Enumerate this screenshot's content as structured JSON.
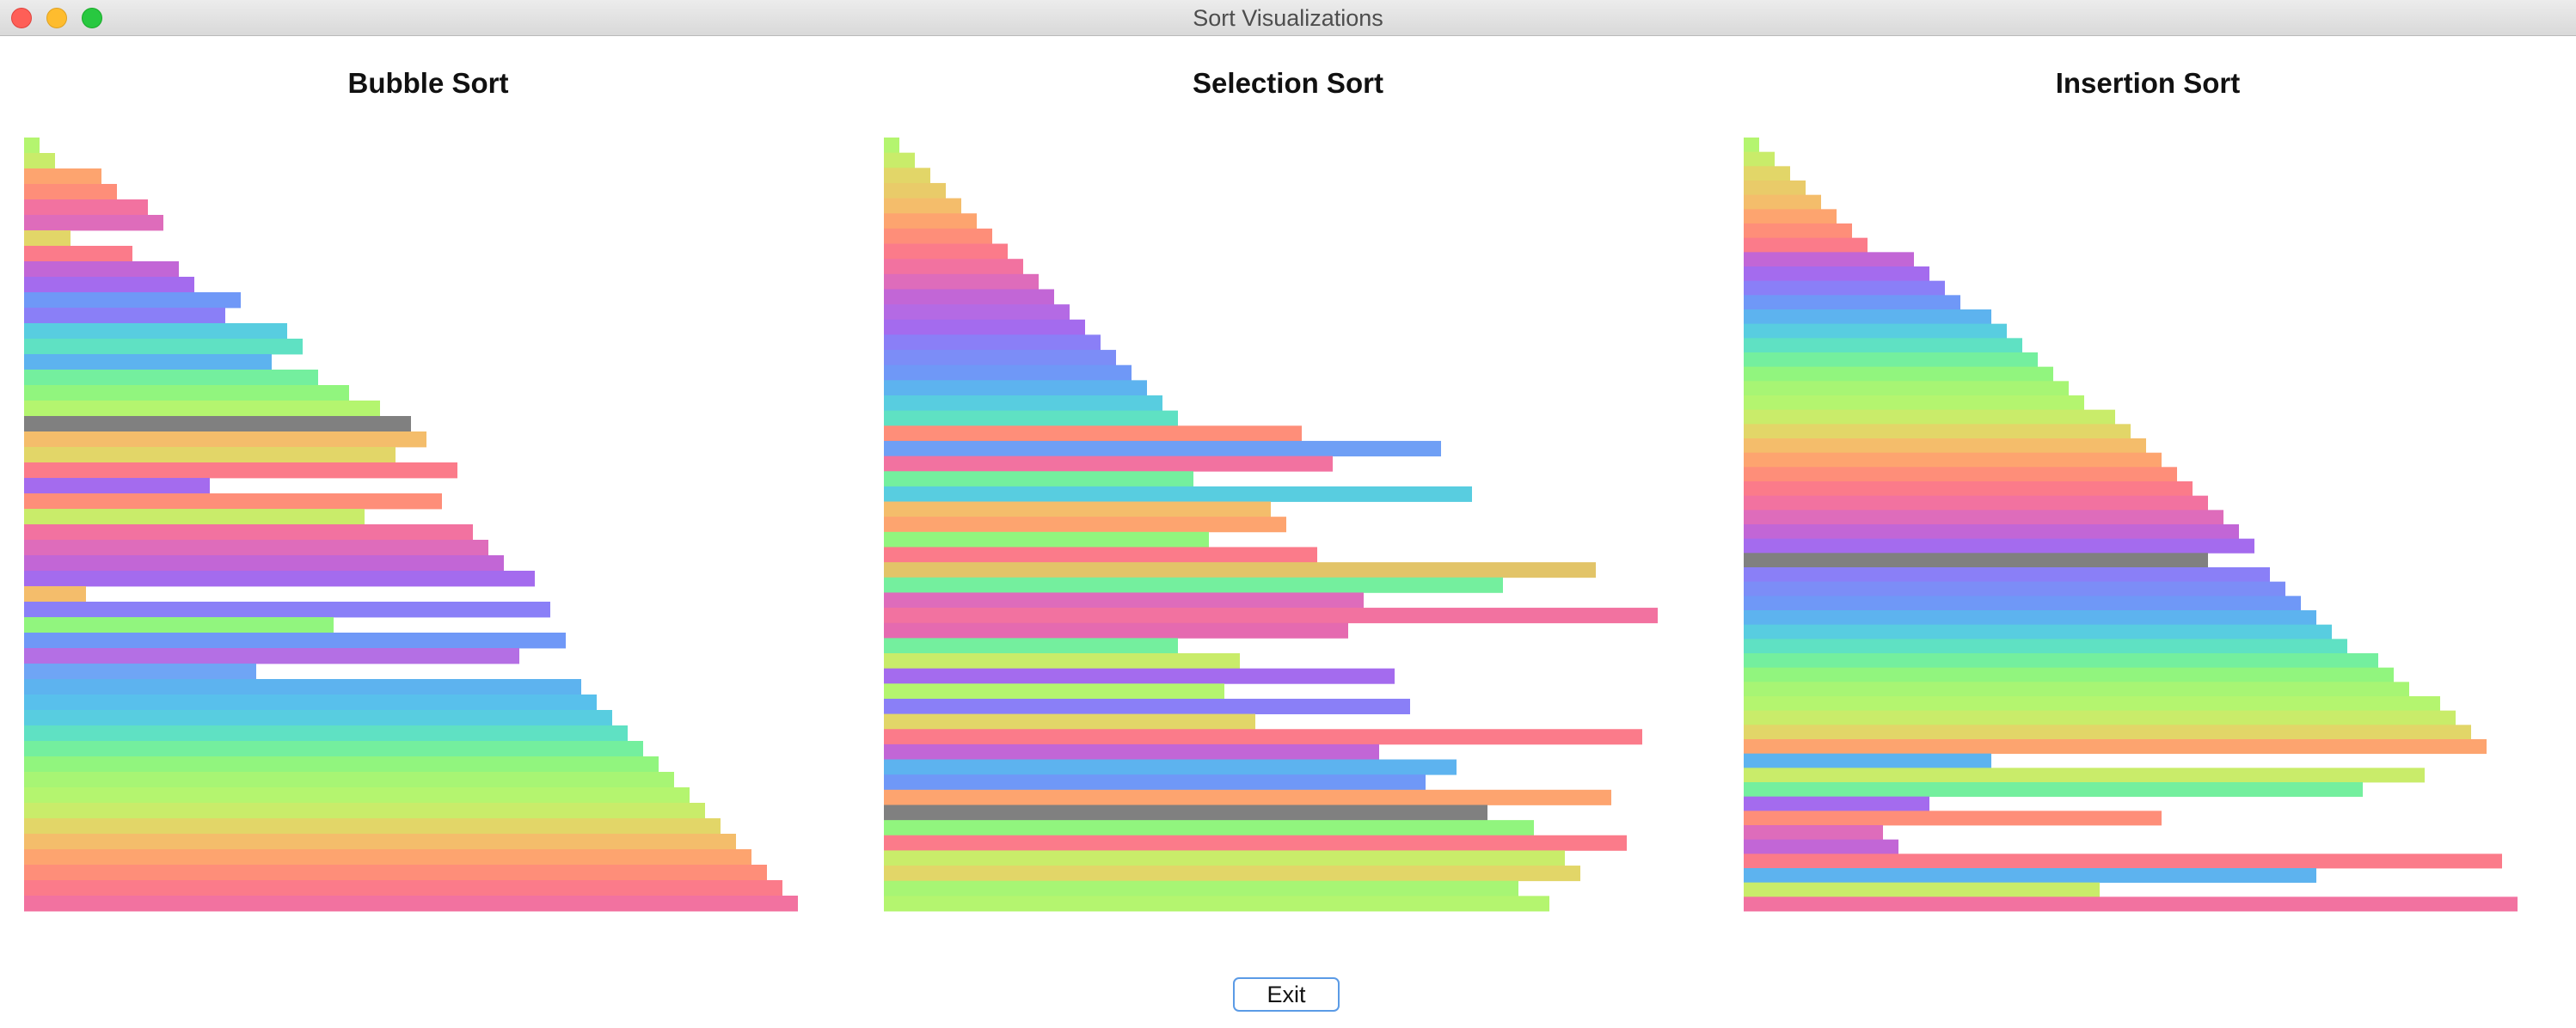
{
  "window": {
    "title": "Sort Visualizations"
  },
  "colors": {
    "highlight": "#808080",
    "palette": [
      "#b4f56f",
      "#c9ec6a",
      "#e2d668",
      "#f4bd6b",
      "#fda46f",
      "#fe8e79",
      "#fb7b8a",
      "#f272a0",
      "#de6cbb",
      "#c266d6",
      "#a46bee",
      "#8a7ff7",
      "#6f98f7",
      "#5db3ef",
      "#58cde0",
      "#5fe1c3",
      "#74ef9e",
      "#91f57e"
    ]
  },
  "panels": [
    {
      "title": "Bubble Sort",
      "bars": [
        {
          "value": 1,
          "color": "#b4f56f"
        },
        {
          "value": 2,
          "color": "#c9ec6a"
        },
        {
          "value": 5,
          "color": "#fda46f"
        },
        {
          "value": 6,
          "color": "#fe8e79"
        },
        {
          "value": 8,
          "color": "#f272a0"
        },
        {
          "value": 9,
          "color": "#de6cbb"
        },
        {
          "value": 3,
          "color": "#e2d668"
        },
        {
          "value": 7,
          "color": "#fb7b8a"
        },
        {
          "value": 10,
          "color": "#c266d6"
        },
        {
          "value": 11,
          "color": "#a46bee"
        },
        {
          "value": 14,
          "color": "#6f98f7"
        },
        {
          "value": 13,
          "color": "#8a7ff7"
        },
        {
          "value": 17,
          "color": "#58cde0"
        },
        {
          "value": 18,
          "color": "#5fe1c3"
        },
        {
          "value": 16,
          "color": "#5db3ef"
        },
        {
          "value": 19,
          "color": "#74ef9e"
        },
        {
          "value": 21,
          "color": "#91f57e"
        },
        {
          "value": 23,
          "color": "#b4f56f"
        },
        {
          "value": 25,
          "color": "#808080"
        },
        {
          "value": 26,
          "color": "#f4bd6b"
        },
        {
          "value": 24,
          "color": "#e2d668"
        },
        {
          "value": 28,
          "color": "#fb7b8a"
        },
        {
          "value": 12,
          "color": "#a46bee"
        },
        {
          "value": 27,
          "color": "#fe8e79"
        },
        {
          "value": 22,
          "color": "#c9ec6a"
        },
        {
          "value": 29,
          "color": "#f272a0"
        },
        {
          "value": 30,
          "color": "#de6cbb"
        },
        {
          "value": 31,
          "color": "#c266d6"
        },
        {
          "value": 33,
          "color": "#a46bee"
        },
        {
          "value": 4,
          "color": "#f4bd6b"
        },
        {
          "value": 34,
          "color": "#8a7ff7"
        },
        {
          "value": 20,
          "color": "#91f57e"
        },
        {
          "value": 35,
          "color": "#6f98f7"
        },
        {
          "value": 32,
          "color": "#b46fe4"
        },
        {
          "value": 15,
          "color": "#6fa5f5"
        },
        {
          "value": 36,
          "color": "#5db3ef"
        },
        {
          "value": 37,
          "color": "#58c0ec"
        },
        {
          "value": 38,
          "color": "#58cde0"
        },
        {
          "value": 39,
          "color": "#5fe1c3"
        },
        {
          "value": 40,
          "color": "#74ef9e"
        },
        {
          "value": 41,
          "color": "#91f57e"
        },
        {
          "value": 42,
          "color": "#a7f574"
        },
        {
          "value": 43,
          "color": "#b4f56f"
        },
        {
          "value": 44,
          "color": "#c9ec6a"
        },
        {
          "value": 45,
          "color": "#e2d668"
        },
        {
          "value": 46,
          "color": "#f4bd6b"
        },
        {
          "value": 47,
          "color": "#fda46f"
        },
        {
          "value": 48,
          "color": "#fe8e79"
        },
        {
          "value": 49,
          "color": "#fb7b8a"
        },
        {
          "value": 50,
          "color": "#f272a0"
        }
      ]
    },
    {
      "title": "Selection Sort",
      "bars": [
        {
          "value": 1,
          "color": "#b4f56f"
        },
        {
          "value": 2,
          "color": "#c9ec6a"
        },
        {
          "value": 3,
          "color": "#e2d668"
        },
        {
          "value": 4,
          "color": "#e9cb69"
        },
        {
          "value": 5,
          "color": "#f4bd6b"
        },
        {
          "value": 6,
          "color": "#fda46f"
        },
        {
          "value": 7,
          "color": "#fe8e79"
        },
        {
          "value": 8,
          "color": "#fb7b8a"
        },
        {
          "value": 9,
          "color": "#f272a0"
        },
        {
          "value": 10,
          "color": "#de6cbb"
        },
        {
          "value": 11,
          "color": "#c266d6"
        },
        {
          "value": 12,
          "color": "#b46ae4"
        },
        {
          "value": 13,
          "color": "#a46bee"
        },
        {
          "value": 14,
          "color": "#8a7ff7"
        },
        {
          "value": 15,
          "color": "#7c8df7"
        },
        {
          "value": 16,
          "color": "#6f98f7"
        },
        {
          "value": 17,
          "color": "#5db3ef"
        },
        {
          "value": 18,
          "color": "#58cde0"
        },
        {
          "value": 19,
          "color": "#5fe1c3"
        },
        {
          "value": 27,
          "color": "#fe8e79"
        },
        {
          "value": 36,
          "color": "#6f9ff5"
        },
        {
          "value": 29,
          "color": "#f272a0"
        },
        {
          "value": 20,
          "color": "#74ef9e"
        },
        {
          "value": 38,
          "color": "#58cde0"
        },
        {
          "value": 25,
          "color": "#f4bd6b"
        },
        {
          "value": 26,
          "color": "#fda46f"
        },
        {
          "value": 21,
          "color": "#91f57e"
        },
        {
          "value": 28,
          "color": "#fb7b8a"
        },
        {
          "value": 46,
          "color": "#e2c468"
        },
        {
          "value": 40,
          "color": "#74ef9e"
        },
        {
          "value": 31,
          "color": "#de6cbb"
        },
        {
          "value": 50,
          "color": "#f272a0"
        },
        {
          "value": 30,
          "color": "#e56ab0"
        },
        {
          "value": 19,
          "color": "#74ef9e"
        },
        {
          "value": 23,
          "color": "#c9ec6a"
        },
        {
          "value": 33,
          "color": "#a46bee"
        },
        {
          "value": 22,
          "color": "#b4f56f"
        },
        {
          "value": 34,
          "color": "#8a7ff7"
        },
        {
          "value": 24,
          "color": "#e2d668"
        },
        {
          "value": 49,
          "color": "#fb7b8a"
        },
        {
          "value": 32,
          "color": "#c266d6"
        },
        {
          "value": 37,
          "color": "#5db3ef"
        },
        {
          "value": 35,
          "color": "#6f98f7"
        },
        {
          "value": 47,
          "color": "#fda46f"
        },
        {
          "value": 39,
          "color": "#808080"
        },
        {
          "value": 42,
          "color": "#91f57e"
        },
        {
          "value": 48,
          "color": "#fb7b8a"
        },
        {
          "value": 44,
          "color": "#c9ec6a"
        },
        {
          "value": 45,
          "color": "#e2d668"
        },
        {
          "value": 41,
          "color": "#a7f574"
        },
        {
          "value": 43,
          "color": "#b4f56f"
        }
      ]
    },
    {
      "title": "Insertion Sort",
      "bars": [
        {
          "value": 1,
          "color": "#b4f56f"
        },
        {
          "value": 2,
          "color": "#c9ec6a"
        },
        {
          "value": 3,
          "color": "#e2d668"
        },
        {
          "value": 4,
          "color": "#e9cb69"
        },
        {
          "value": 5,
          "color": "#f4bd6b"
        },
        {
          "value": 6,
          "color": "#fda46f"
        },
        {
          "value": 7,
          "color": "#fe8e79"
        },
        {
          "value": 8,
          "color": "#fb7b8a"
        },
        {
          "value": 11,
          "color": "#c266d6"
        },
        {
          "value": 12,
          "color": "#a46bee"
        },
        {
          "value": 13,
          "color": "#8a7ff7"
        },
        {
          "value": 14,
          "color": "#6f98f7"
        },
        {
          "value": 16,
          "color": "#5db3ef"
        },
        {
          "value": 17,
          "color": "#58cde0"
        },
        {
          "value": 18,
          "color": "#5fe1c3"
        },
        {
          "value": 19,
          "color": "#74ef9e"
        },
        {
          "value": 20,
          "color": "#91f57e"
        },
        {
          "value": 21,
          "color": "#a7f574"
        },
        {
          "value": 22,
          "color": "#b4f56f"
        },
        {
          "value": 24,
          "color": "#c9ec6a"
        },
        {
          "value": 25,
          "color": "#e2d668"
        },
        {
          "value": 26,
          "color": "#f4bd6b"
        },
        {
          "value": 27,
          "color": "#fda46f"
        },
        {
          "value": 28,
          "color": "#fe8e79"
        },
        {
          "value": 29,
          "color": "#fb7b8a"
        },
        {
          "value": 30,
          "color": "#f272a0"
        },
        {
          "value": 31,
          "color": "#de6cbb"
        },
        {
          "value": 32,
          "color": "#c266d6"
        },
        {
          "value": 33,
          "color": "#a46bee"
        },
        {
          "value": 30,
          "color": "#808080"
        },
        {
          "value": 34,
          "color": "#8a7ff7"
        },
        {
          "value": 35,
          "color": "#7c8df7"
        },
        {
          "value": 36,
          "color": "#6f98f7"
        },
        {
          "value": 37,
          "color": "#5db3ef"
        },
        {
          "value": 38,
          "color": "#58cde0"
        },
        {
          "value": 39,
          "color": "#5fe1c3"
        },
        {
          "value": 41,
          "color": "#74ef9e"
        },
        {
          "value": 42,
          "color": "#91f57e"
        },
        {
          "value": 43,
          "color": "#a7f574"
        },
        {
          "value": 45,
          "color": "#b4f56f"
        },
        {
          "value": 46,
          "color": "#c9ec6a"
        },
        {
          "value": 47,
          "color": "#e2d668"
        },
        {
          "value": 48,
          "color": "#fda46f"
        },
        {
          "value": 16,
          "color": "#5db3ef"
        },
        {
          "value": 44,
          "color": "#c9ec6a"
        },
        {
          "value": 40,
          "color": "#74ef9e"
        },
        {
          "value": 12,
          "color": "#a46bee"
        },
        {
          "value": 27,
          "color": "#fe8e79"
        },
        {
          "value": 9,
          "color": "#de6cbb"
        },
        {
          "value": 10,
          "color": "#c266d6"
        },
        {
          "value": 49,
          "color": "#fb7b8a"
        },
        {
          "value": 37,
          "color": "#5db3ef"
        },
        {
          "value": 23,
          "color": "#c9ec6a"
        },
        {
          "value": 50,
          "color": "#f272a0"
        }
      ]
    }
  ],
  "buttons": {
    "exit_label": "Exit"
  }
}
